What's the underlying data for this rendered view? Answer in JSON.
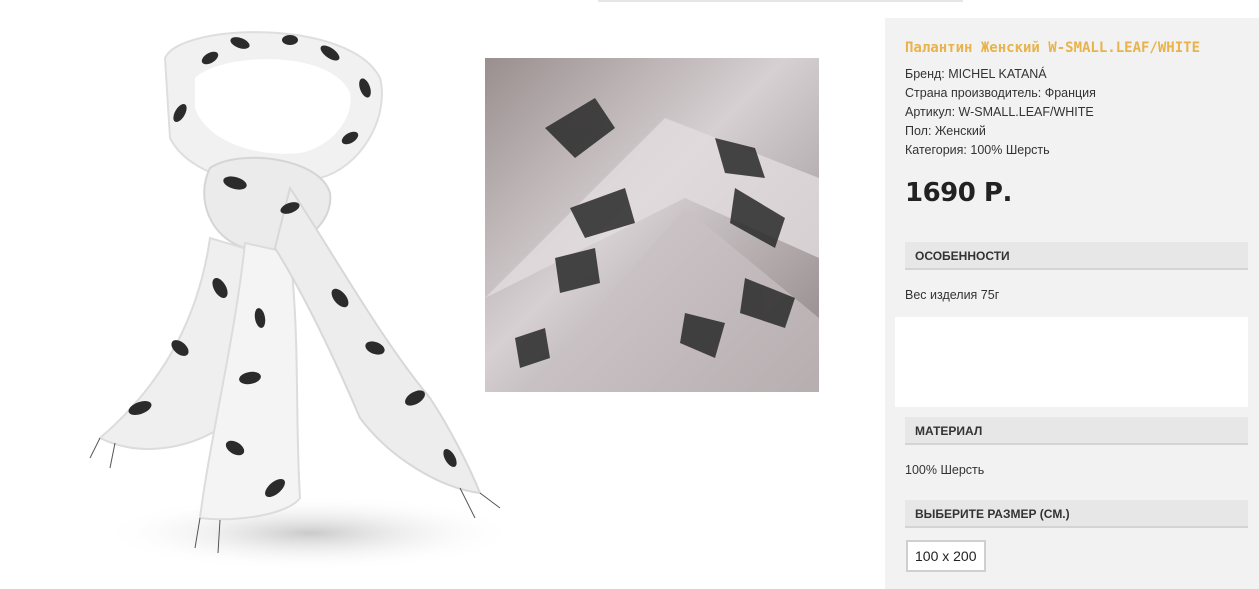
{
  "product": {
    "title": "Палантин Женский W-SMALL.LEAF/WHITE",
    "attributes": [
      "Бренд: MICHEL KATANÁ",
      "Страна производитель: Франция",
      "Артикул: W-SMALL.LEAF/WHITE",
      "Пол: Женский",
      "Категория: 100% Шерсть"
    ],
    "price": "1690 Р."
  },
  "sections": {
    "features": {
      "header": "ОСОБЕННОСТИ",
      "text": "Вес изделия 75г"
    },
    "material": {
      "header": "МАТЕРИАЛ",
      "text": "100% Шерсть"
    },
    "size": {
      "header": "ВЫБЕРИТЕ РАЗМЕР (СМ.)",
      "options": [
        "100 x 200"
      ]
    }
  },
  "colors": {
    "accent": "#e8b34a",
    "panel": "#f2f2f2",
    "section_header": "#e7e7e7"
  }
}
